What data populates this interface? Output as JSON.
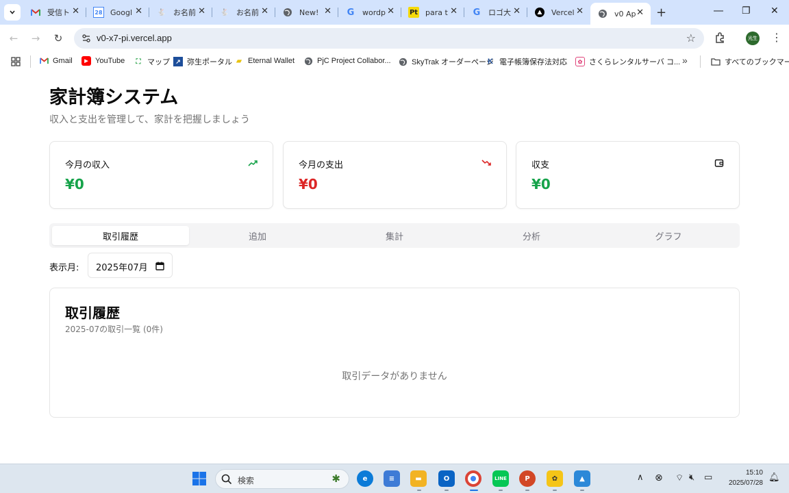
{
  "browser": {
    "tabs": [
      {
        "title": "受信ト",
        "icon": "gmail-icon",
        "active": false
      },
      {
        "title": "Googl",
        "icon": "google-calendar-icon",
        "active": false
      },
      {
        "title": "お名前",
        "icon": "rabbit-icon",
        "active": false
      },
      {
        "title": "お名前",
        "icon": "rabbit-icon",
        "active": false
      },
      {
        "title": "New!",
        "icon": "globe-icon",
        "active": false
      },
      {
        "title": "wordp",
        "icon": "google-icon",
        "active": false
      },
      {
        "title": "para t",
        "icon": "pt-icon",
        "active": false
      },
      {
        "title": "ロゴ大",
        "icon": "google-icon",
        "active": false
      },
      {
        "title": "Vercel",
        "icon": "vercel-icon",
        "active": false
      },
      {
        "title": "v0 Ap",
        "icon": "globe-icon",
        "active": true
      }
    ],
    "url": "v0-x7-pi.vercel.app",
    "profile_label": "光生",
    "bookmarks": [
      {
        "label": "Gmail",
        "icon": "gmail-icon"
      },
      {
        "label": "YouTube",
        "icon": "youtube-icon"
      },
      {
        "label": "マップ",
        "icon": "maps-icon"
      },
      {
        "label": "弥生ポータル",
        "icon": "yayoi-icon"
      },
      {
        "label": "Eternal Wallet",
        "icon": "wallet-icon"
      },
      {
        "label": "PjC Project Collabor...",
        "icon": "globe-icon"
      },
      {
        "label": "SkyTrak オーダーページ",
        "icon": "globe-icon"
      },
      {
        "label": "電子帳簿保存法対応",
        "icon": "k-icon"
      },
      {
        "label": "さくらレンタルサーバ コ...",
        "icon": "sakura-icon"
      }
    ],
    "all_bookmarks_label": "すべてのブックマーク"
  },
  "app": {
    "title": "家計簿システム",
    "subtitle": "収入と支出を管理して、家計を把握しましょう",
    "cards": [
      {
        "label": "今月の収入",
        "value": "¥0",
        "color": "#16a34a",
        "icon": "trending-up-icon"
      },
      {
        "label": "今月の支出",
        "value": "¥0",
        "color": "#dc2626",
        "icon": "trending-down-icon"
      },
      {
        "label": "収支",
        "value": "¥0",
        "color": "#16a34a",
        "icon": "wallet-icon"
      }
    ],
    "tabs": [
      "取引履歴",
      "追加",
      "集計",
      "分析",
      "グラフ"
    ],
    "active_tab": "取引履歴",
    "month_label": "表示月:",
    "month_value": "2025年07月",
    "history": {
      "title": "取引履歴",
      "description": "2025-07の取引一覧 (0件)",
      "empty_text": "取引データがありません"
    }
  },
  "taskbar": {
    "search_placeholder": "検索",
    "time": "15:10",
    "date": "2025/07/28"
  }
}
